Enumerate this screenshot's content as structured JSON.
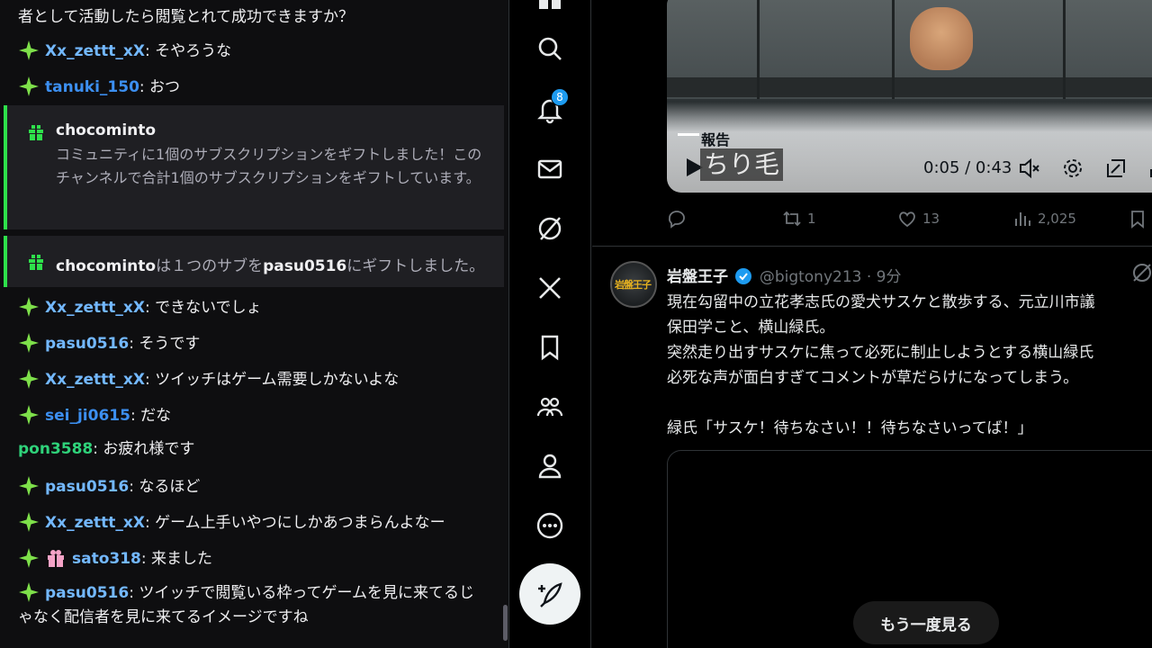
{
  "chat": {
    "top_fragment": "者として活動したら閲覧とれて成功できますか？",
    "messages": [
      {
        "user": "Xx_zettt_xX",
        "text": ": そやろうな"
      },
      {
        "user": "tanuki_150",
        "text": ": おつ"
      },
      {
        "user": "Xx_zettt_xX",
        "text": ": できないでしょ"
      },
      {
        "user": "pasu0516",
        "text": ": そうです"
      },
      {
        "user": "Xx_zettt_xX",
        "text": ": ツイッチはゲーム需要しかないよな"
      },
      {
        "user": "sei_ji0615",
        "text": ": だな"
      },
      {
        "user": "pon3588",
        "text": ": お疲れ様です"
      },
      {
        "user": "pasu0516",
        "text": ": なるほど"
      },
      {
        "user": "Xx_zettt_xX",
        "text": ": ゲーム上手いやつにしかあつまらんよなー"
      },
      {
        "user": "sato318",
        "text": ": 来ました"
      },
      {
        "user": "pasu0516",
        "text": ": ツイッチで閲覧いる枠ってゲームを見に来てるじゃなく配信者を見に来てるイメージですね"
      }
    ],
    "sub_gift": {
      "user": "chocominto",
      "text": "コミュニティに1個のサブスクリプションをギフトしました！このチャンネルで合計1個のサブスクリプションをギフトしています。"
    },
    "sub_gift_single": {
      "user": "chocominto",
      "middle": "は１つのサブを",
      "recipient": "pasu0516",
      "end": "にギフトしました。"
    }
  },
  "nav": {
    "notification_count": "8",
    "icons": [
      "home-icon",
      "search-icon",
      "notifications-icon",
      "messages-icon",
      "grok-icon",
      "x-premium-icon",
      "bookmarks-icon",
      "communities-icon",
      "profile-icon",
      "more-icon",
      "compose-icon"
    ]
  },
  "video": {
    "report_label": "報告",
    "subtitle": "ちり毛",
    "time": "0:05 / 0:43"
  },
  "actions": {
    "retweets": "1",
    "likes": "13",
    "views": "2,025"
  },
  "post": {
    "name": "岩盤王子",
    "handle": "@bigtony213 · 9分",
    "avatar_text": "岩盤王子",
    "body": "現在勾留中の立花孝志氏の愛犬サスケと散歩する、元立川市議\n保田学こと、横山緑氏。\n突然走り出すサスケに焦って必死に制止しようとする横山緑氏\n必死な声が面白すぎてコメントが草だらけになってしまう。\n\n緑氏「サスケ！待ちなさい！！待ちなさいってば！」",
    "replay_label": "もう一度見る"
  },
  "colors": {
    "sub_accent": "#2ee14b",
    "twitter_blue": "#1d9bf0",
    "user_blue": "#3c8ff0",
    "user_green": "#2fd27a"
  }
}
